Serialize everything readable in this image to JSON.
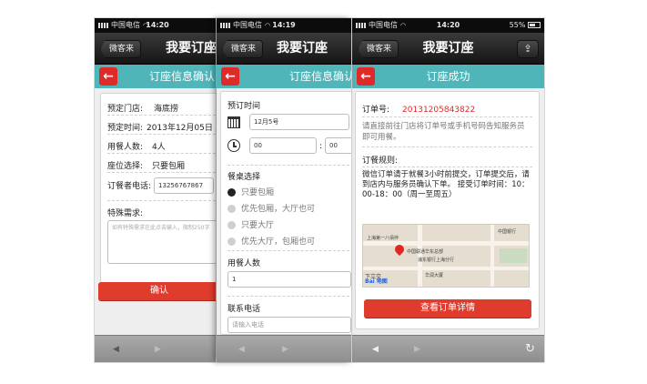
{
  "status_bar": {
    "carrier": "中国电信",
    "time_1": "14:20",
    "time_2": "14:19",
    "time_3": "14:20",
    "battery": "55%"
  },
  "navbar": {
    "back_label": "微客来",
    "title": "我要订座",
    "title_success": "我要订座"
  },
  "screen1": {
    "header": "订座信息确认",
    "store_label": "预定门店:",
    "store_value": "海底捞",
    "time_label": "预定时间:",
    "time_value": "2013年12月05日",
    "people_label": "用餐人数:",
    "people_value": "4人",
    "seat_label": "座位选择:",
    "seat_value": "只要包厢",
    "phone_label": "订餐者电话:",
    "phone_value": "13256767867",
    "note_label": "特殊需求:",
    "note_placeholder": "如有特殊需求在此点击输入，限制250字",
    "confirm_label": "确认"
  },
  "screen2": {
    "header": "订座信息确认",
    "time_title": "预订时间",
    "date_value": "12月5号",
    "hour_value": "00",
    "minute_value": "00",
    "table_title": "餐桌选择",
    "options": [
      {
        "label": "只要包厢",
        "selected": true
      },
      {
        "label": "优先包厢，大厅也可",
        "selected": false
      },
      {
        "label": "只要大厅",
        "selected": false
      },
      {
        "label": "优先大厅，包厢也可",
        "selected": false
      }
    ],
    "people_title": "用餐人数",
    "people_value": "1",
    "phone_title": "联系电话",
    "phone_placeholder": "请输入电话"
  },
  "screen3": {
    "header": "订座成功",
    "order_label": "订单号:",
    "order_value": "20131205843822",
    "order_note": "请直接前往门店将订单号或手机号码告知服务员即可用餐。",
    "rules_title": "订餐规则:",
    "rules_text": "微信订单请于就餐3小时前提交，订单提交后，请到店内与服务员确认下单。 接受订单时间：10：00-18：00（周一至周五）",
    "details_label": "查看订单详情",
    "map_labels": {
      "street": "上海第一八佰伴",
      "poi": "中国联通华东总部",
      "poi2": "浦东银行上海分行",
      "area": "下立交",
      "bank": "中国银行",
      "ave": "华润大厦"
    },
    "map_brand": "Bai 地图"
  },
  "toolbar": {
    "back_arrow": "◀",
    "forward_arrow": "▶",
    "refresh": "↻"
  },
  "colors": {
    "accent_teal": "#4fb5b9",
    "action_red": "#e03c2e",
    "order_red": "#e02a2a"
  }
}
